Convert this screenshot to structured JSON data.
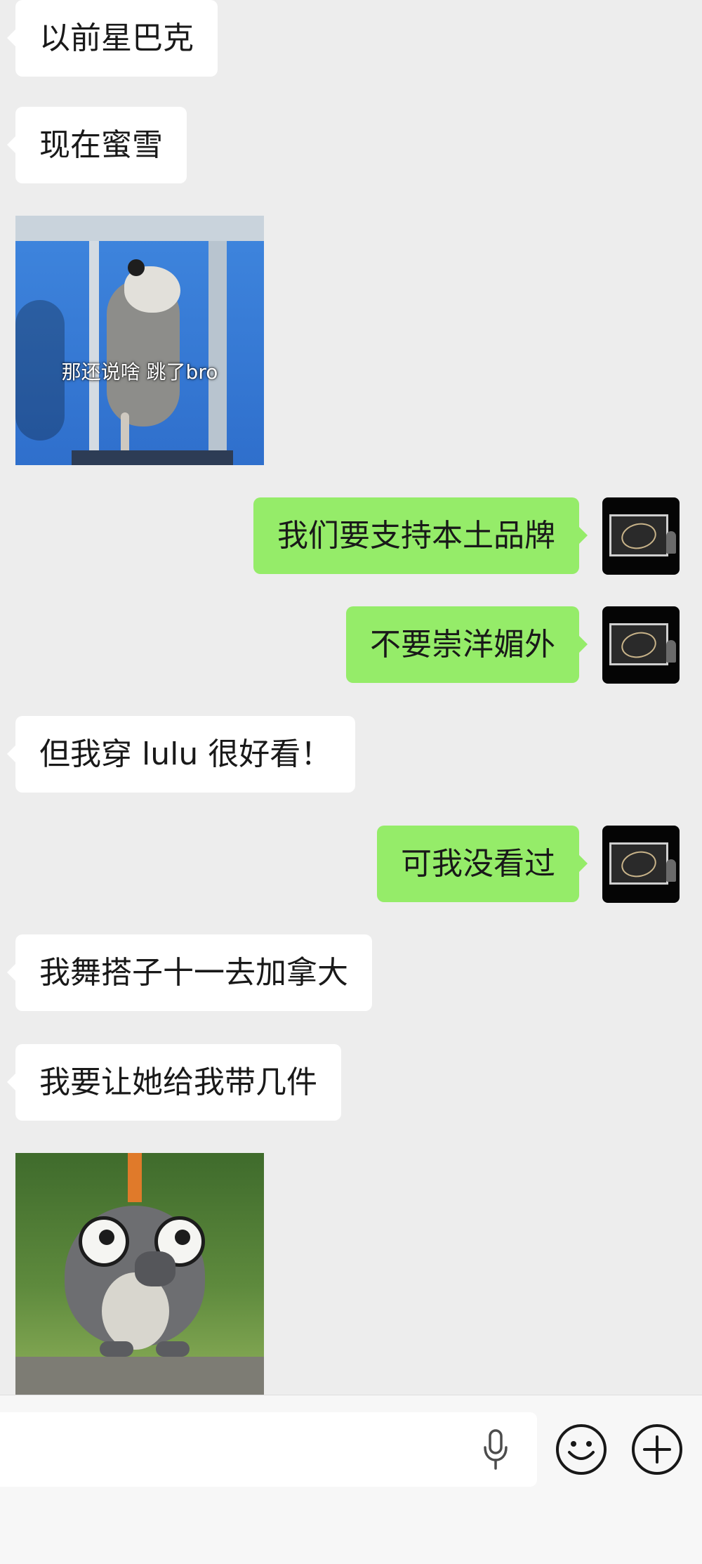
{
  "messages": [
    {
      "side": "left",
      "type": "text",
      "text": "以前星巴克"
    },
    {
      "side": "left",
      "type": "text",
      "text": "现在蜜雪"
    },
    {
      "side": "left",
      "type": "sticker",
      "sticker": "opossum-window",
      "caption": "那还说啥 跳了bro"
    },
    {
      "side": "right",
      "type": "text",
      "text": "我们要支持本土品牌"
    },
    {
      "side": "right",
      "type": "text",
      "text": "不要崇洋媚外"
    },
    {
      "side": "left",
      "type": "text",
      "text": "但我穿 lulu 很好看！"
    },
    {
      "side": "right",
      "type": "text",
      "text": "可我没看过"
    },
    {
      "side": "left",
      "type": "text",
      "text": "我舞搭子十一去加拿大"
    },
    {
      "side": "left",
      "type": "text",
      "text": "我要让她给我带几件"
    },
    {
      "side": "left",
      "type": "sticker",
      "sticker": "raccoon-glasses",
      "caption": ""
    }
  ],
  "input": {
    "value": "",
    "placeholder": ""
  },
  "icons": {
    "voice": "microphone-icon",
    "emoji": "emoji-icon",
    "more": "plus-icon"
  },
  "colors": {
    "chat_background": "#ededed",
    "incoming_bubble": "#ffffff",
    "outgoing_bubble": "#95ec69",
    "input_bar": "#f7f7f7",
    "text": "#191919"
  }
}
